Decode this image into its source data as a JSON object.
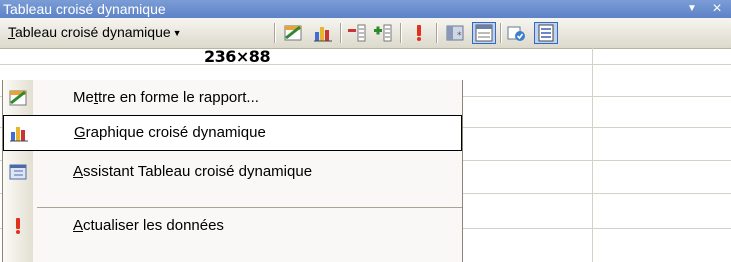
{
  "window": {
    "title": "Tableau croisé dynamique",
    "dropdown_glyph": "▼",
    "close_glyph": "×"
  },
  "toolbar": {
    "menu_button": {
      "mnemonic": "T",
      "rest": "ableau croisé dynamique",
      "arrow": "▼"
    },
    "icons": [
      "format-report-icon",
      "pivot-chart-icon",
      "hide-detail-icon",
      "show-detail-icon",
      "refresh-data-icon",
      "include-hidden-items-icon",
      "always-display-items-icon",
      "field-settings-icon",
      "field-list-icon"
    ]
  },
  "size_annotation": "236×88",
  "menu": {
    "items": [
      {
        "icon": "format-report-icon",
        "pre": "Me",
        "mnemonic": "t",
        "post": "tre en forme le rapport...",
        "highlighted": false
      },
      {
        "icon": "pivot-chart-icon",
        "pre": "",
        "mnemonic": "G",
        "post": "raphique croisé dynamique",
        "highlighted": true
      },
      {
        "icon": "pivot-wizard-icon",
        "pre": "",
        "mnemonic": "A",
        "post": "ssistant Tableau croisé dynamique",
        "highlighted": false
      },
      {
        "icon": "refresh-data-icon",
        "pre": "",
        "mnemonic": "A",
        "post": "ctualiser les données",
        "highlighted": false
      }
    ]
  },
  "colors": {
    "titlebar": "#5d82c7",
    "highlight_bg": "#c1d2ee",
    "highlight_border": "#316ac5",
    "menu_bg": "#f9f8f7"
  }
}
